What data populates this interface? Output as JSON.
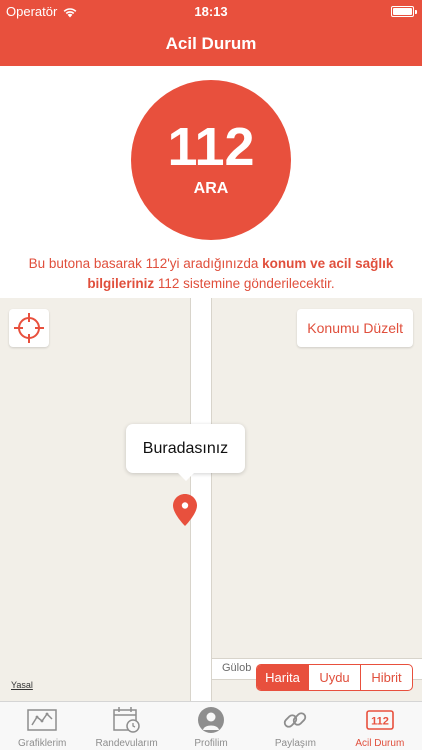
{
  "status_bar": {
    "carrier": "Operatör",
    "time": "18:13"
  },
  "nav": {
    "title": "Acil Durum"
  },
  "call_button": {
    "number": "112",
    "label": "ARA"
  },
  "info_text": {
    "part1": "Bu butona basarak 112'yi aradığınızda ",
    "bold": "konum ve acil sağlık bilgileriniz",
    "part2": " 112 sistemine gönderilecektir."
  },
  "map": {
    "fix_location_label": "Konumu Düzelt",
    "callout_text": "Buradasınız",
    "street_label": "Gülob",
    "legal_label": "Yasal",
    "map_types": [
      "Harita",
      "Uydu",
      "Hibrit"
    ],
    "selected_map_type": "Harita"
  },
  "tabs": [
    {
      "label": "Grafiklerim",
      "icon": "chart-icon"
    },
    {
      "label": "Randevularım",
      "icon": "calendar-icon"
    },
    {
      "label": "Profilim",
      "icon": "profile-icon"
    },
    {
      "label": "Paylaşım",
      "icon": "link-icon"
    },
    {
      "label": "Acil Durum",
      "icon": "112-icon",
      "icon_text": "112"
    }
  ],
  "active_tab": "Acil Durum",
  "colors": {
    "accent": "#e8503d",
    "map_background": "#f2efe8",
    "tab_inactive": "#8e8e8e"
  }
}
